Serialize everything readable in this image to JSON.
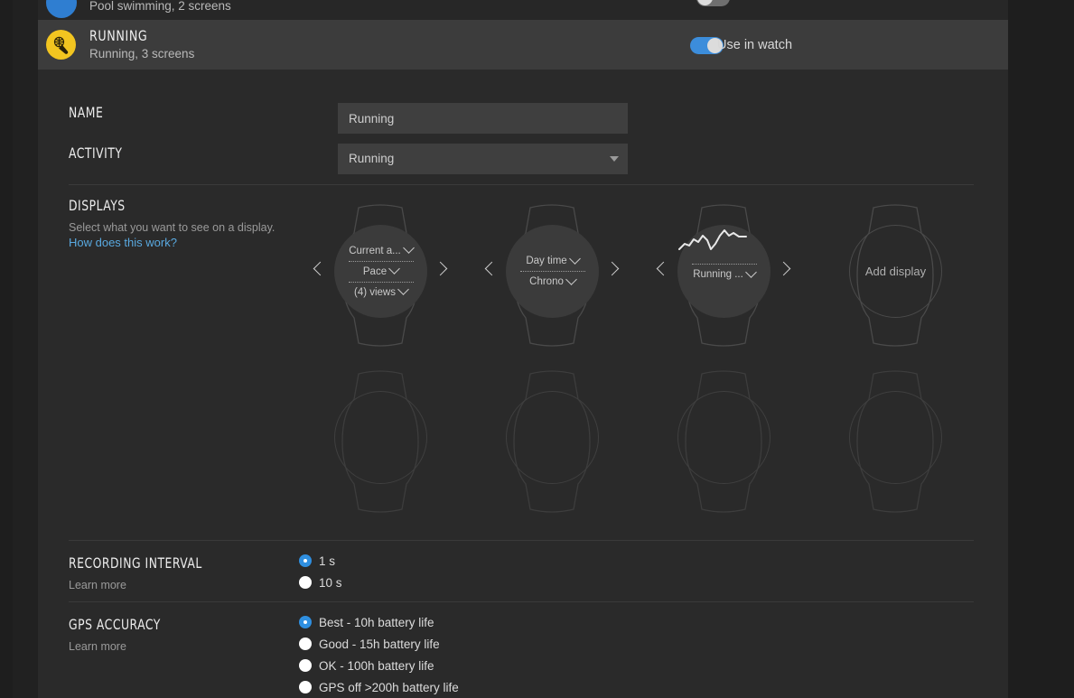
{
  "sport_rows": {
    "previous": {
      "subtitle": "Pool swimming, 2 screens",
      "icon": "pool-swimming-icon",
      "icon_color": "#2f7ed1"
    },
    "current": {
      "title": "RUNNING",
      "subtitle": "Running, 3 screens",
      "icon": "running-shoe-icon",
      "icon_color": "#f2c520",
      "toggle_label": "Use in watch",
      "toggle_state": "on",
      "toggle_color": "#3c8ddb"
    }
  },
  "form": {
    "name_label": "NAME",
    "name_value": "Running",
    "name_placeholder": "Running",
    "activity_label": "ACTIVITY",
    "activity_value": "Running"
  },
  "displays": {
    "label": "DISPLAYS",
    "description": "Select what you want to see on a display.",
    "help_link": "How does this work?",
    "add_display_label": "Add display",
    "watches": [
      {
        "type": "configured",
        "rows": [
          {
            "text": "Current a...",
            "has_chevron": true
          },
          {
            "text": "Pace",
            "has_chevron": true
          },
          {
            "text": "(4) views",
            "has_chevron": true
          }
        ]
      },
      {
        "type": "configured",
        "rows": [
          {
            "text": "Day time",
            "has_chevron": true
          },
          {
            "text": "Chrono",
            "has_chevron": true
          }
        ]
      },
      {
        "type": "configured",
        "graphic": "line-chart-icon",
        "rows": [
          {
            "text": "Running ...",
            "has_chevron": true
          }
        ]
      },
      {
        "type": "add"
      },
      {
        "type": "empty"
      },
      {
        "type": "empty"
      },
      {
        "type": "empty"
      },
      {
        "type": "empty"
      }
    ]
  },
  "recording_interval": {
    "label": "RECORDING INTERVAL",
    "learn_more": "Learn more",
    "options": [
      {
        "label": "1 s",
        "selected": true
      },
      {
        "label": "10 s",
        "selected": false
      }
    ]
  },
  "gps_accuracy": {
    "label": "GPS ACCURACY",
    "learn_more": "Learn more",
    "options": [
      {
        "label": "Best - 10h battery life",
        "selected": true
      },
      {
        "label": "Good - 15h battery life",
        "selected": false
      },
      {
        "label": "OK - 100h battery life",
        "selected": false
      },
      {
        "label": "GPS off >200h battery life",
        "selected": false
      }
    ]
  },
  "colors": {
    "accent": "#3c8ddb",
    "panel": "#2a2a2a",
    "row_active": "#3c3c3c",
    "link": "#59a9e0"
  }
}
